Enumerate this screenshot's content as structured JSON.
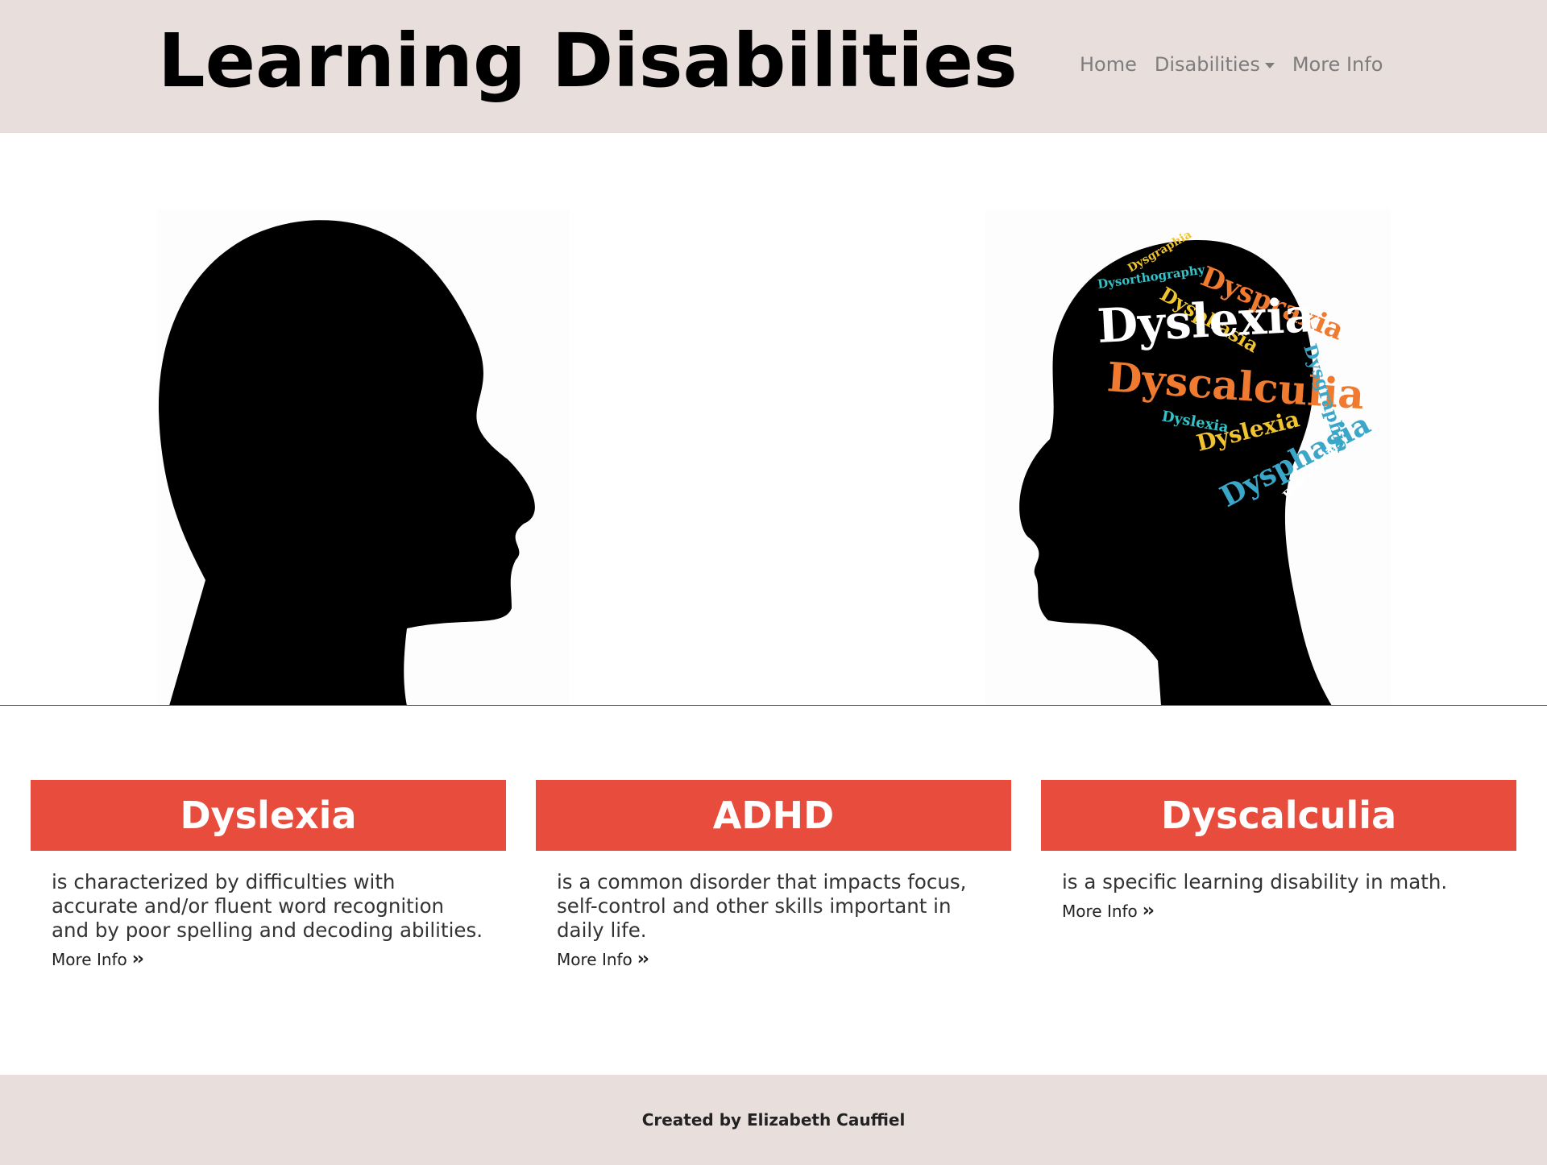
{
  "header": {
    "title": "Learning Disabilities",
    "nav": [
      {
        "label": "Home"
      },
      {
        "label": "Disabilities"
      },
      {
        "label": "More Info"
      }
    ]
  },
  "hero": {
    "word_cloud": [
      {
        "text": "Dyspraxia",
        "color": "#f07a30"
      },
      {
        "text": "Dysgraphia",
        "color": "#f0c430"
      },
      {
        "text": "Dysorthography",
        "color": "#34c1c7"
      },
      {
        "text": "Dysphasia",
        "color": "#f0c430"
      },
      {
        "text": "Dyslexia",
        "color": "#ffffff"
      },
      {
        "text": "Dyscalculia",
        "color": "#f07a30"
      },
      {
        "text": "Dysgraphia",
        "color": "#3aa7c9"
      },
      {
        "text": "Dyslexia",
        "color": "#34c1c7"
      },
      {
        "text": "Dyslexia",
        "color": "#f0c430"
      },
      {
        "text": "Dysphasia",
        "color": "#3aa7c9"
      },
      {
        "text": "Dyscalculia",
        "color": "#ffffff"
      }
    ]
  },
  "cards": [
    {
      "title": "Dyslexia",
      "text": "is characterized by difficulties with accurate and/or fluent word recognition and by poor spelling and decoding abilities.",
      "link": "More Info"
    },
    {
      "title": "ADHD",
      "text": "is a common disorder that impacts focus, self-control and other skills important in daily life.",
      "link": "More Info"
    },
    {
      "title": "Dyscalculia",
      "text": "is a specific learning disability in math.",
      "link": "More Info"
    }
  ],
  "footer": {
    "text": "Created by Elizabeth Cauffiel"
  },
  "colors": {
    "header_bg": "#e8dedb",
    "card_accent": "#e74c3c",
    "nav_text": "#7d7d7d"
  }
}
